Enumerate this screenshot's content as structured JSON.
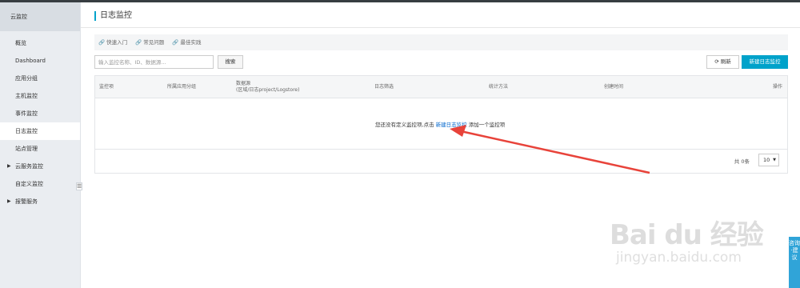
{
  "sidebar": {
    "title": "云监控",
    "items": [
      {
        "label": "概览",
        "active": false,
        "expandable": false
      },
      {
        "label": "Dashboard",
        "active": false,
        "expandable": false
      },
      {
        "label": "应用分组",
        "active": false,
        "expandable": false
      },
      {
        "label": "主机监控",
        "active": false,
        "expandable": false
      },
      {
        "label": "事件监控",
        "active": false,
        "expandable": false
      },
      {
        "label": "日志监控",
        "active": true,
        "expandable": false
      },
      {
        "label": "站点管理",
        "active": false,
        "expandable": false
      },
      {
        "label": "云服务监控",
        "active": false,
        "expandable": true
      },
      {
        "label": "自定义监控",
        "active": false,
        "expandable": false
      },
      {
        "label": "报警服务",
        "active": false,
        "expandable": true
      }
    ],
    "collapse_icon": "☰"
  },
  "header": {
    "title": "日志监控"
  },
  "help_links": [
    {
      "label": "快速入门",
      "icon": "link-icon"
    },
    {
      "label": "常见问题",
      "icon": "link-icon"
    },
    {
      "label": "最佳实践",
      "icon": "link-icon"
    }
  ],
  "toolbar": {
    "search_placeholder": "输入监控名称、ID、数据源...",
    "search_value": "",
    "search_label": "搜索",
    "refresh_label": "刷新",
    "create_label": "新建日志监控"
  },
  "table": {
    "columns": [
      {
        "label": "监控项"
      },
      {
        "label": "所属应用分组"
      },
      {
        "label": "数据源",
        "sub": "(区域/日志project/Logstore)"
      },
      {
        "label": "日志筛选"
      },
      {
        "label": "统计方法"
      },
      {
        "label": "创建时间"
      },
      {
        "label": "操作"
      }
    ],
    "empty": {
      "prefix": "您还没有定义监控项,点击",
      "link": "新建日志监控",
      "suffix": "添加一个监控项"
    }
  },
  "pager": {
    "total_text": "共 0条",
    "page_size": "10"
  },
  "watermark": {
    "logo": "Bai du 经验",
    "url": "jingyan.baidu.com"
  },
  "side_tab": {
    "label": "咨询·建议"
  },
  "colors": {
    "accent": "#00a2ca",
    "link": "#0066cc",
    "annotation": "#e8433a",
    "sidebar_bg": "#eaedf1"
  }
}
